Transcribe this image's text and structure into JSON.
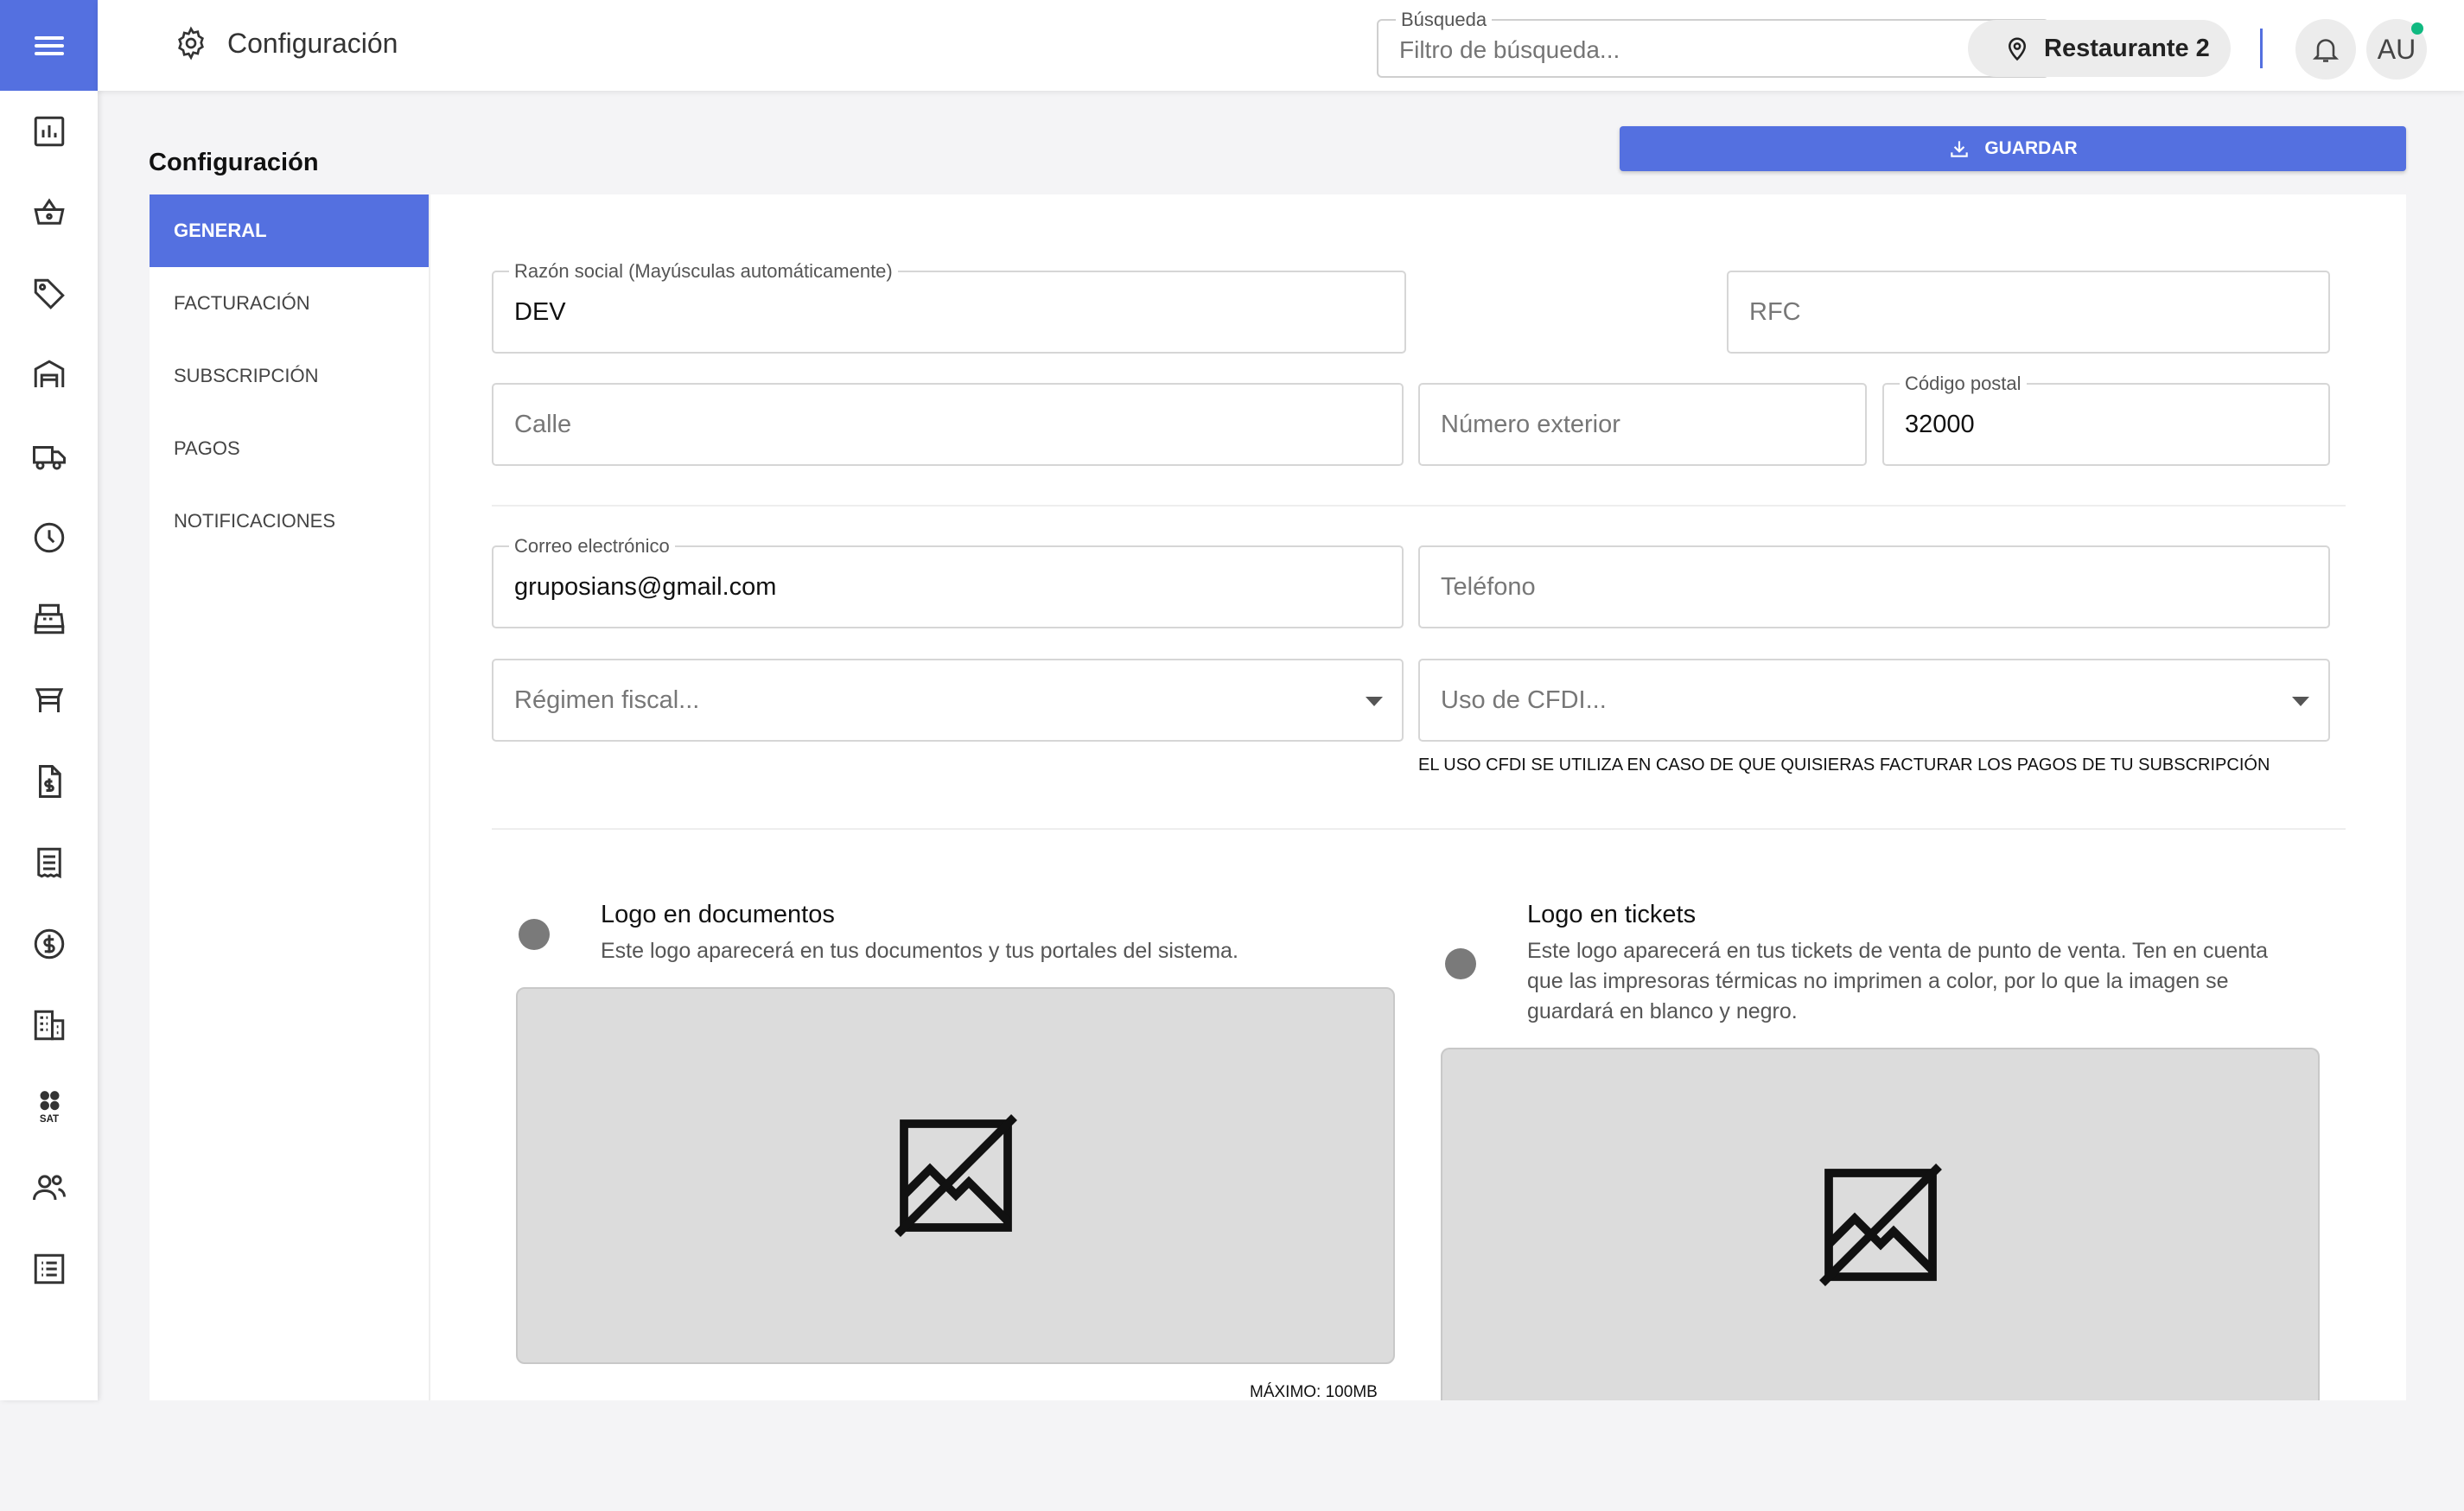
{
  "header": {
    "page_title": "Configuración",
    "search_label": "Búsqueda",
    "search_placeholder": "Filtro de búsqueda...",
    "branch": "Restaurante 2",
    "user_initials": "AU"
  },
  "section_heading": "Configuración",
  "save_label": "GUARDAR",
  "tabs": [
    {
      "label": "GENERAL",
      "active": true
    },
    {
      "label": "FACTURACIÓN",
      "active": false
    },
    {
      "label": "SUBSCRIPCIÓN",
      "active": false
    },
    {
      "label": "PAGOS",
      "active": false
    },
    {
      "label": "NOTIFICACIONES",
      "active": false
    }
  ],
  "form": {
    "razon_social": {
      "label": "Razón social (Mayúsculas automáticamente)",
      "value": "DEV"
    },
    "rfc": {
      "placeholder": "RFC"
    },
    "calle": {
      "placeholder": "Calle"
    },
    "numero_exterior": {
      "placeholder": "Número exterior"
    },
    "codigo_postal": {
      "label": "Código postal",
      "value": "32000"
    },
    "correo": {
      "label": "Correo electrónico",
      "value": "gruposians@gmail.com"
    },
    "telefono": {
      "placeholder": "Teléfono"
    },
    "regimen_fiscal": {
      "placeholder": "Régimen fiscal..."
    },
    "uso_cfdi": {
      "placeholder": "Uso de CFDI..."
    },
    "cfdi_hint": "EL USO CFDI SE UTILIZA EN CASO DE QUE QUISIERAS FACTURAR LOS PAGOS DE TU SUBSCRIPCIÓN"
  },
  "logos": {
    "documents": {
      "title": "Logo en documentos",
      "description": "Este logo aparecerá en tus documentos y tus portales del sistema.",
      "max_size": "MÁXIMO: 100MB"
    },
    "tickets": {
      "title": "Logo en tickets",
      "description": "Este logo aparecerá en tus tickets de venta de punto de venta. Ten en cuenta que las impresoras térmicas no imprimen a color, por lo que la imagen se guardará en blanco y negro."
    }
  },
  "sidebar_icons": [
    "chart-icon",
    "basket-icon",
    "tag-icon",
    "warehouse-icon",
    "truck-icon",
    "clock-icon",
    "cash-register-icon",
    "table-icon",
    "invoice-icon",
    "receipt-icon",
    "dollar-icon",
    "building-icon",
    "sat-icon",
    "users-icon",
    "list-icon"
  ],
  "colors": {
    "accent": "#5470e0",
    "online": "#10b981"
  }
}
